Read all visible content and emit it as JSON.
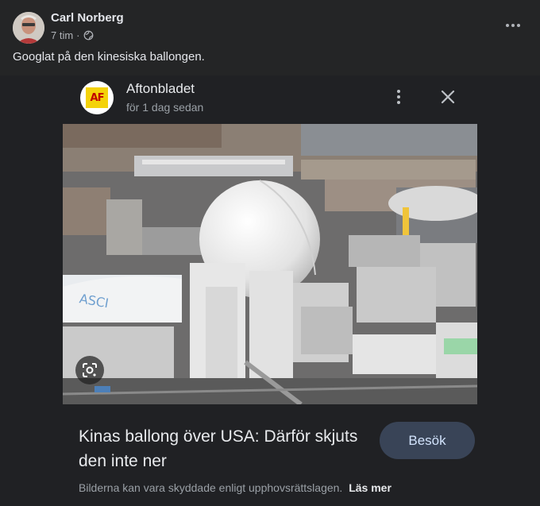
{
  "post": {
    "author": "Carl Norberg",
    "time": "7 tim",
    "separator": "·",
    "text": "Googlat på den kinesiska ballongen."
  },
  "card": {
    "source_name": "Aftonbladet",
    "source_logo_text": "AF",
    "source_time": "för 1 dag sedan",
    "headline": "Kinas ballong över USA: Därför skjuts den inte ner",
    "visit_label": "Besök",
    "footnote": "Bilderna kan vara skyddade enligt upphovsrättslagen.",
    "learn_more": "Läs mer"
  },
  "colors": {
    "background": "#242526",
    "card_background": "#202124",
    "button_bg": "#394457",
    "button_text": "#d2e3fc"
  },
  "icons": {
    "globe": "globe-icon",
    "more": "more-horizontal-icon",
    "kebab": "more-vertical-icon",
    "close": "close-icon",
    "lens": "google-lens-icon"
  }
}
